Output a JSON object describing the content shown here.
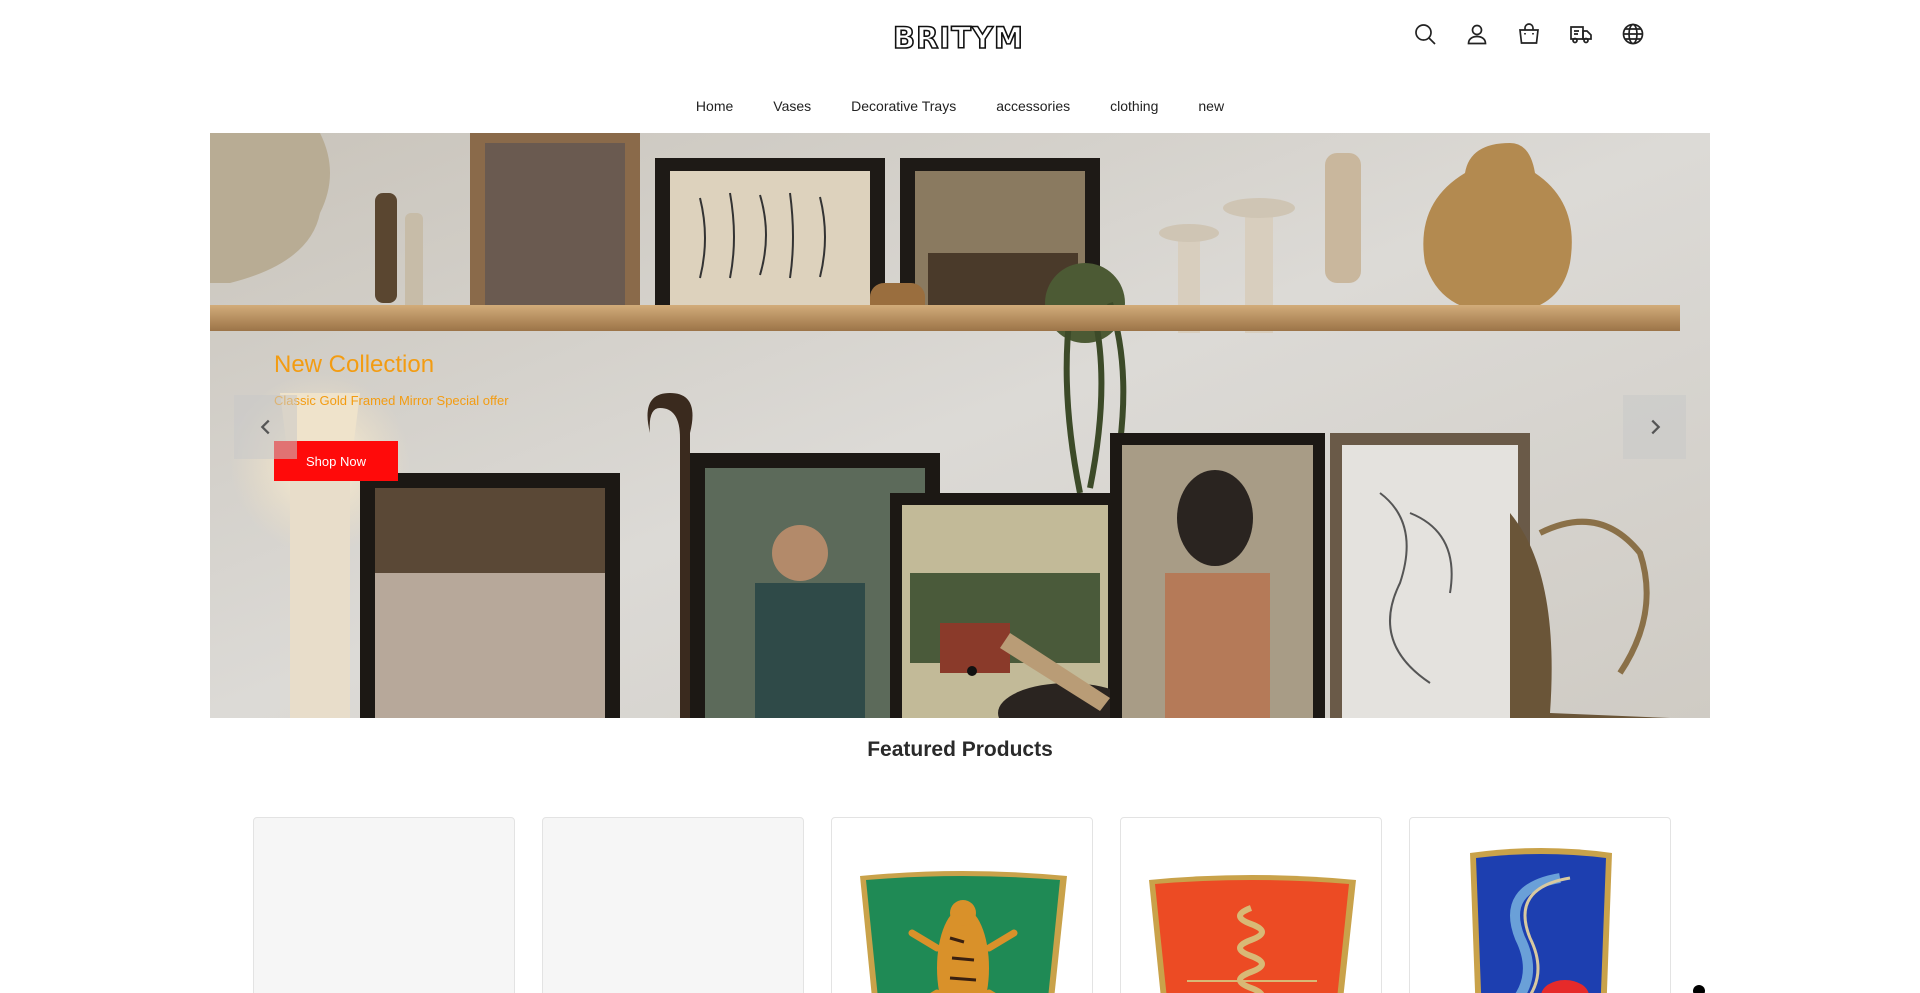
{
  "brand": {
    "logo_text": "BRITYM"
  },
  "header": {
    "icons": [
      "search-icon",
      "account-icon",
      "cart-icon",
      "delivery-truck-icon",
      "globe-icon"
    ]
  },
  "nav": {
    "items": [
      {
        "label": "Home"
      },
      {
        "label": "Vases"
      },
      {
        "label": "Decorative Trays"
      },
      {
        "label": "accessories"
      },
      {
        "label": "clothing"
      },
      {
        "label": "new"
      }
    ]
  },
  "hero": {
    "title": "New Collection",
    "subtitle": "Classic Gold Framed Mirror Special offer",
    "button_label": "Shop Now",
    "title_color": "#f39c12",
    "button_color": "#ff0a0a"
  },
  "featured": {
    "title": "Featured Products",
    "products": [
      {
        "image": "placeholder"
      },
      {
        "image": "placeholder"
      },
      {
        "image": "green-tiger-tray"
      },
      {
        "image": "orange-snake-tray"
      },
      {
        "image": "blue-lips-tray"
      }
    ]
  }
}
